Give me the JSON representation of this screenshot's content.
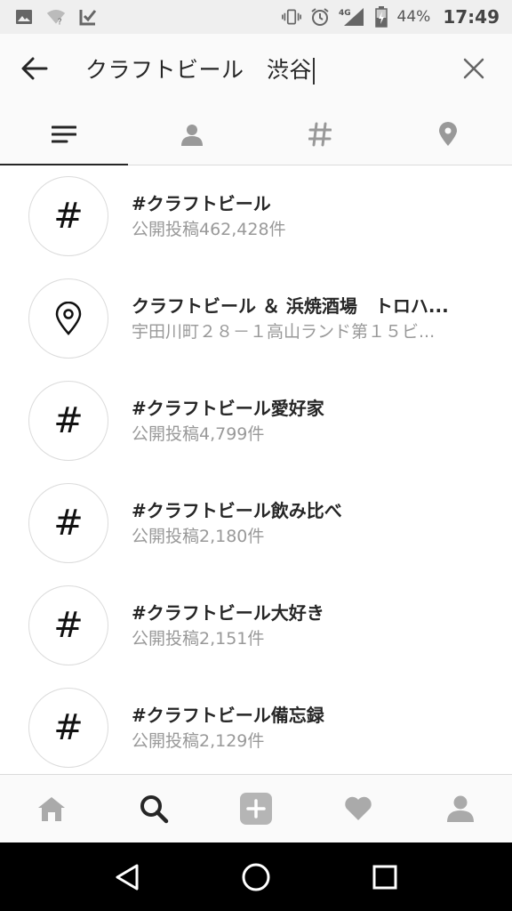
{
  "status_bar": {
    "battery": "44%",
    "time": "17:49",
    "network": "4G",
    "icons": [
      "image-icon",
      "wifi-unknown-icon",
      "download-check-icon",
      "vibrate-icon",
      "alarm-icon",
      "signal-icon",
      "battery-charging-icon"
    ]
  },
  "search": {
    "query": "クラフトビール　渋谷",
    "back_icon": "arrow-left-icon",
    "clear_icon": "close-icon"
  },
  "tabs": [
    {
      "name": "top",
      "icon": "lines-icon",
      "active": true
    },
    {
      "name": "accounts",
      "icon": "person-icon",
      "active": false
    },
    {
      "name": "tags",
      "icon": "hashtag-icon",
      "active": false
    },
    {
      "name": "places",
      "icon": "location-pin-icon",
      "active": false
    }
  ],
  "results": [
    {
      "type": "hashtag",
      "title": "#クラフトビール",
      "subtitle": "公開投稿462,428件"
    },
    {
      "type": "place",
      "title": "クラフトビール ＆ 浜焼酒場　トロハ...",
      "subtitle": "宇田川町２８－１高山ランド第１５ビ..."
    },
    {
      "type": "hashtag",
      "title": "#クラフトビール愛好家",
      "subtitle": "公開投稿4,799件"
    },
    {
      "type": "hashtag",
      "title": "#クラフトビール飲み比べ",
      "subtitle": "公開投稿2,180件"
    },
    {
      "type": "hashtag",
      "title": "#クラフトビール大好き",
      "subtitle": "公開投稿2,151件"
    },
    {
      "type": "hashtag",
      "title": "#クラフトビール備忘録",
      "subtitle": "公開投稿2,129件"
    }
  ],
  "bottom_nav": [
    "home-icon",
    "search-icon",
    "add-post-icon",
    "heart-icon",
    "profile-icon"
  ],
  "system_nav": [
    "back-triangle-icon",
    "home-circle-icon",
    "recents-square-icon"
  ],
  "colors": {
    "text_primary": "#262626",
    "text_secondary": "#999999",
    "divider": "#dbdbdb",
    "bar_bg": "#fafafa"
  }
}
